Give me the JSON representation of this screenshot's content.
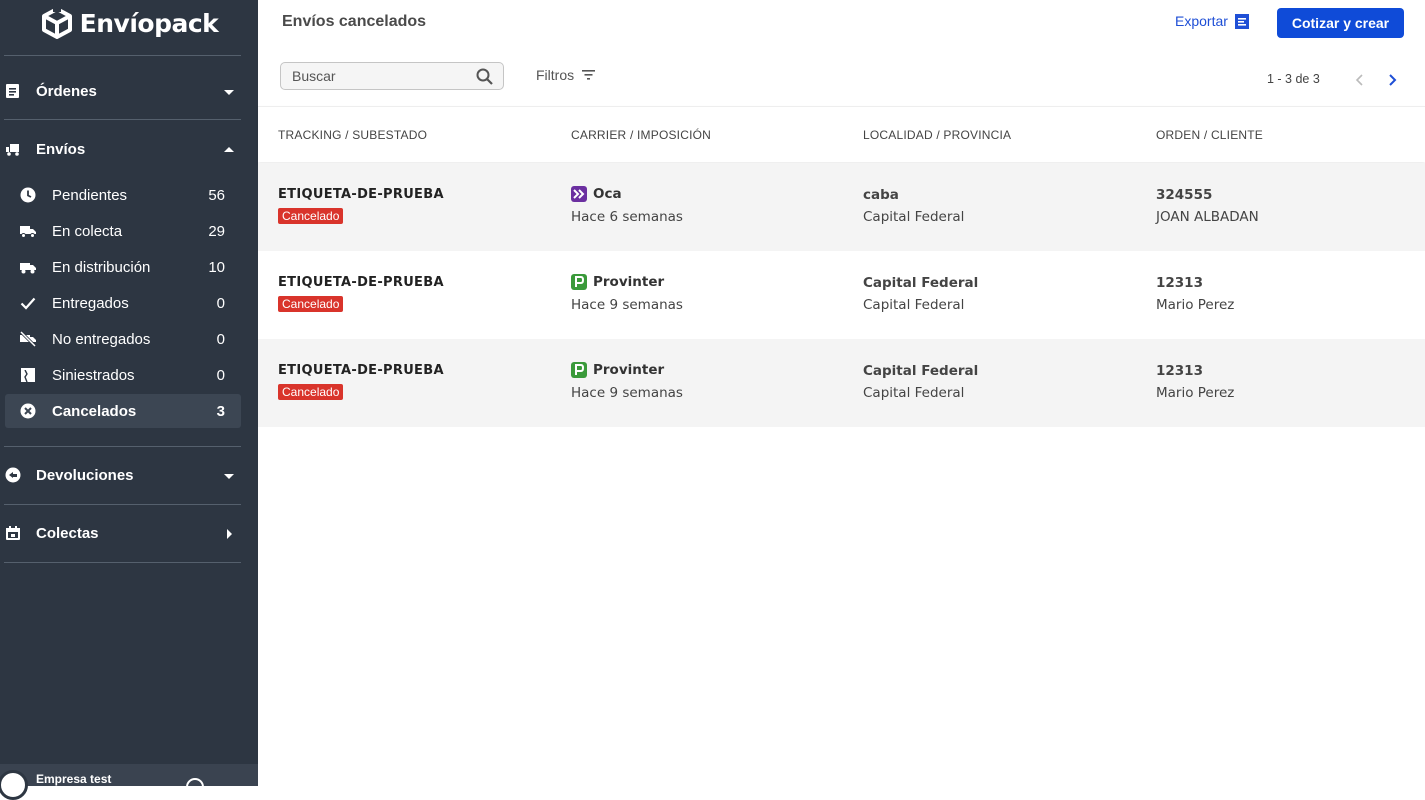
{
  "brand": {
    "name": "Envíopack"
  },
  "sidebar": {
    "sections": [
      {
        "label": "Órdenes",
        "icon": "orders-icon",
        "state": "collapsed"
      },
      {
        "label": "Envíos",
        "icon": "shipping-icon",
        "state": "expanded"
      },
      {
        "label": "Devoluciones",
        "icon": "returns-icon",
        "state": "collapsed"
      },
      {
        "label": "Colectas",
        "icon": "calendar-icon",
        "state": "collapsed-right"
      }
    ],
    "envios_items": [
      {
        "label": "Pendientes",
        "count": "56",
        "icon": "clock-icon"
      },
      {
        "label": "En colecta",
        "count": "29",
        "icon": "truck-icon"
      },
      {
        "label": "En distribución",
        "count": "10",
        "icon": "delivery-truck-icon"
      },
      {
        "label": "Entregados",
        "count": "0",
        "icon": "check-icon"
      },
      {
        "label": "No entregados",
        "count": "0",
        "icon": "not-delivered-icon"
      },
      {
        "label": "Siniestrados",
        "count": "0",
        "icon": "damaged-box-icon"
      },
      {
        "label": "Cancelados",
        "count": "3",
        "icon": "cancel-circle-icon",
        "active": true
      }
    ],
    "footer": {
      "company": "Empresa test"
    }
  },
  "header": {
    "title": "Envíos cancelados",
    "export_label": "Exportar",
    "create_label": "Cotizar y crear"
  },
  "toolbar": {
    "search_placeholder": "Buscar",
    "filters_label": "Filtros",
    "pagination": "1 - 3 de 3"
  },
  "table": {
    "columns": [
      "TRACKING / SUBESTADO",
      "CARRIER / IMPOSICIÓN",
      "LOCALIDAD / PROVINCIA",
      "ORDEN / CLIENTE"
    ],
    "rows": [
      {
        "tracking": "ETIQUETA-DE-PRUEBA",
        "status": "Cancelado",
        "carrier": "Oca",
        "carrier_logo": "oca-logo-icon",
        "time": "Hace 6 semanas",
        "locality": "caba",
        "province": "Capital Federal",
        "order": "324555",
        "client": "JOAN ALBADAN"
      },
      {
        "tracking": "ETIQUETA-DE-PRUEBA",
        "status": "Cancelado",
        "carrier": "Provinter",
        "carrier_logo": "provinter-logo-icon",
        "time": "Hace 9 semanas",
        "locality": "Capital Federal",
        "province": "Capital Federal",
        "order": "12313",
        "client": "Mario Perez"
      },
      {
        "tracking": "ETIQUETA-DE-PRUEBA",
        "status": "Cancelado",
        "carrier": "Provinter",
        "carrier_logo": "provinter-logo-icon",
        "time": "Hace 9 semanas",
        "locality": "Capital Federal",
        "province": "Capital Federal",
        "order": "12313",
        "client": "Mario Perez"
      }
    ]
  },
  "colors": {
    "sidebar_bg": "#2d3642",
    "primary": "#0f4bd8",
    "link": "#1f4fd6",
    "badge_red": "#d9342b",
    "oca_purple": "#6b2fa0",
    "provinter_green": "#3a9a3a"
  }
}
